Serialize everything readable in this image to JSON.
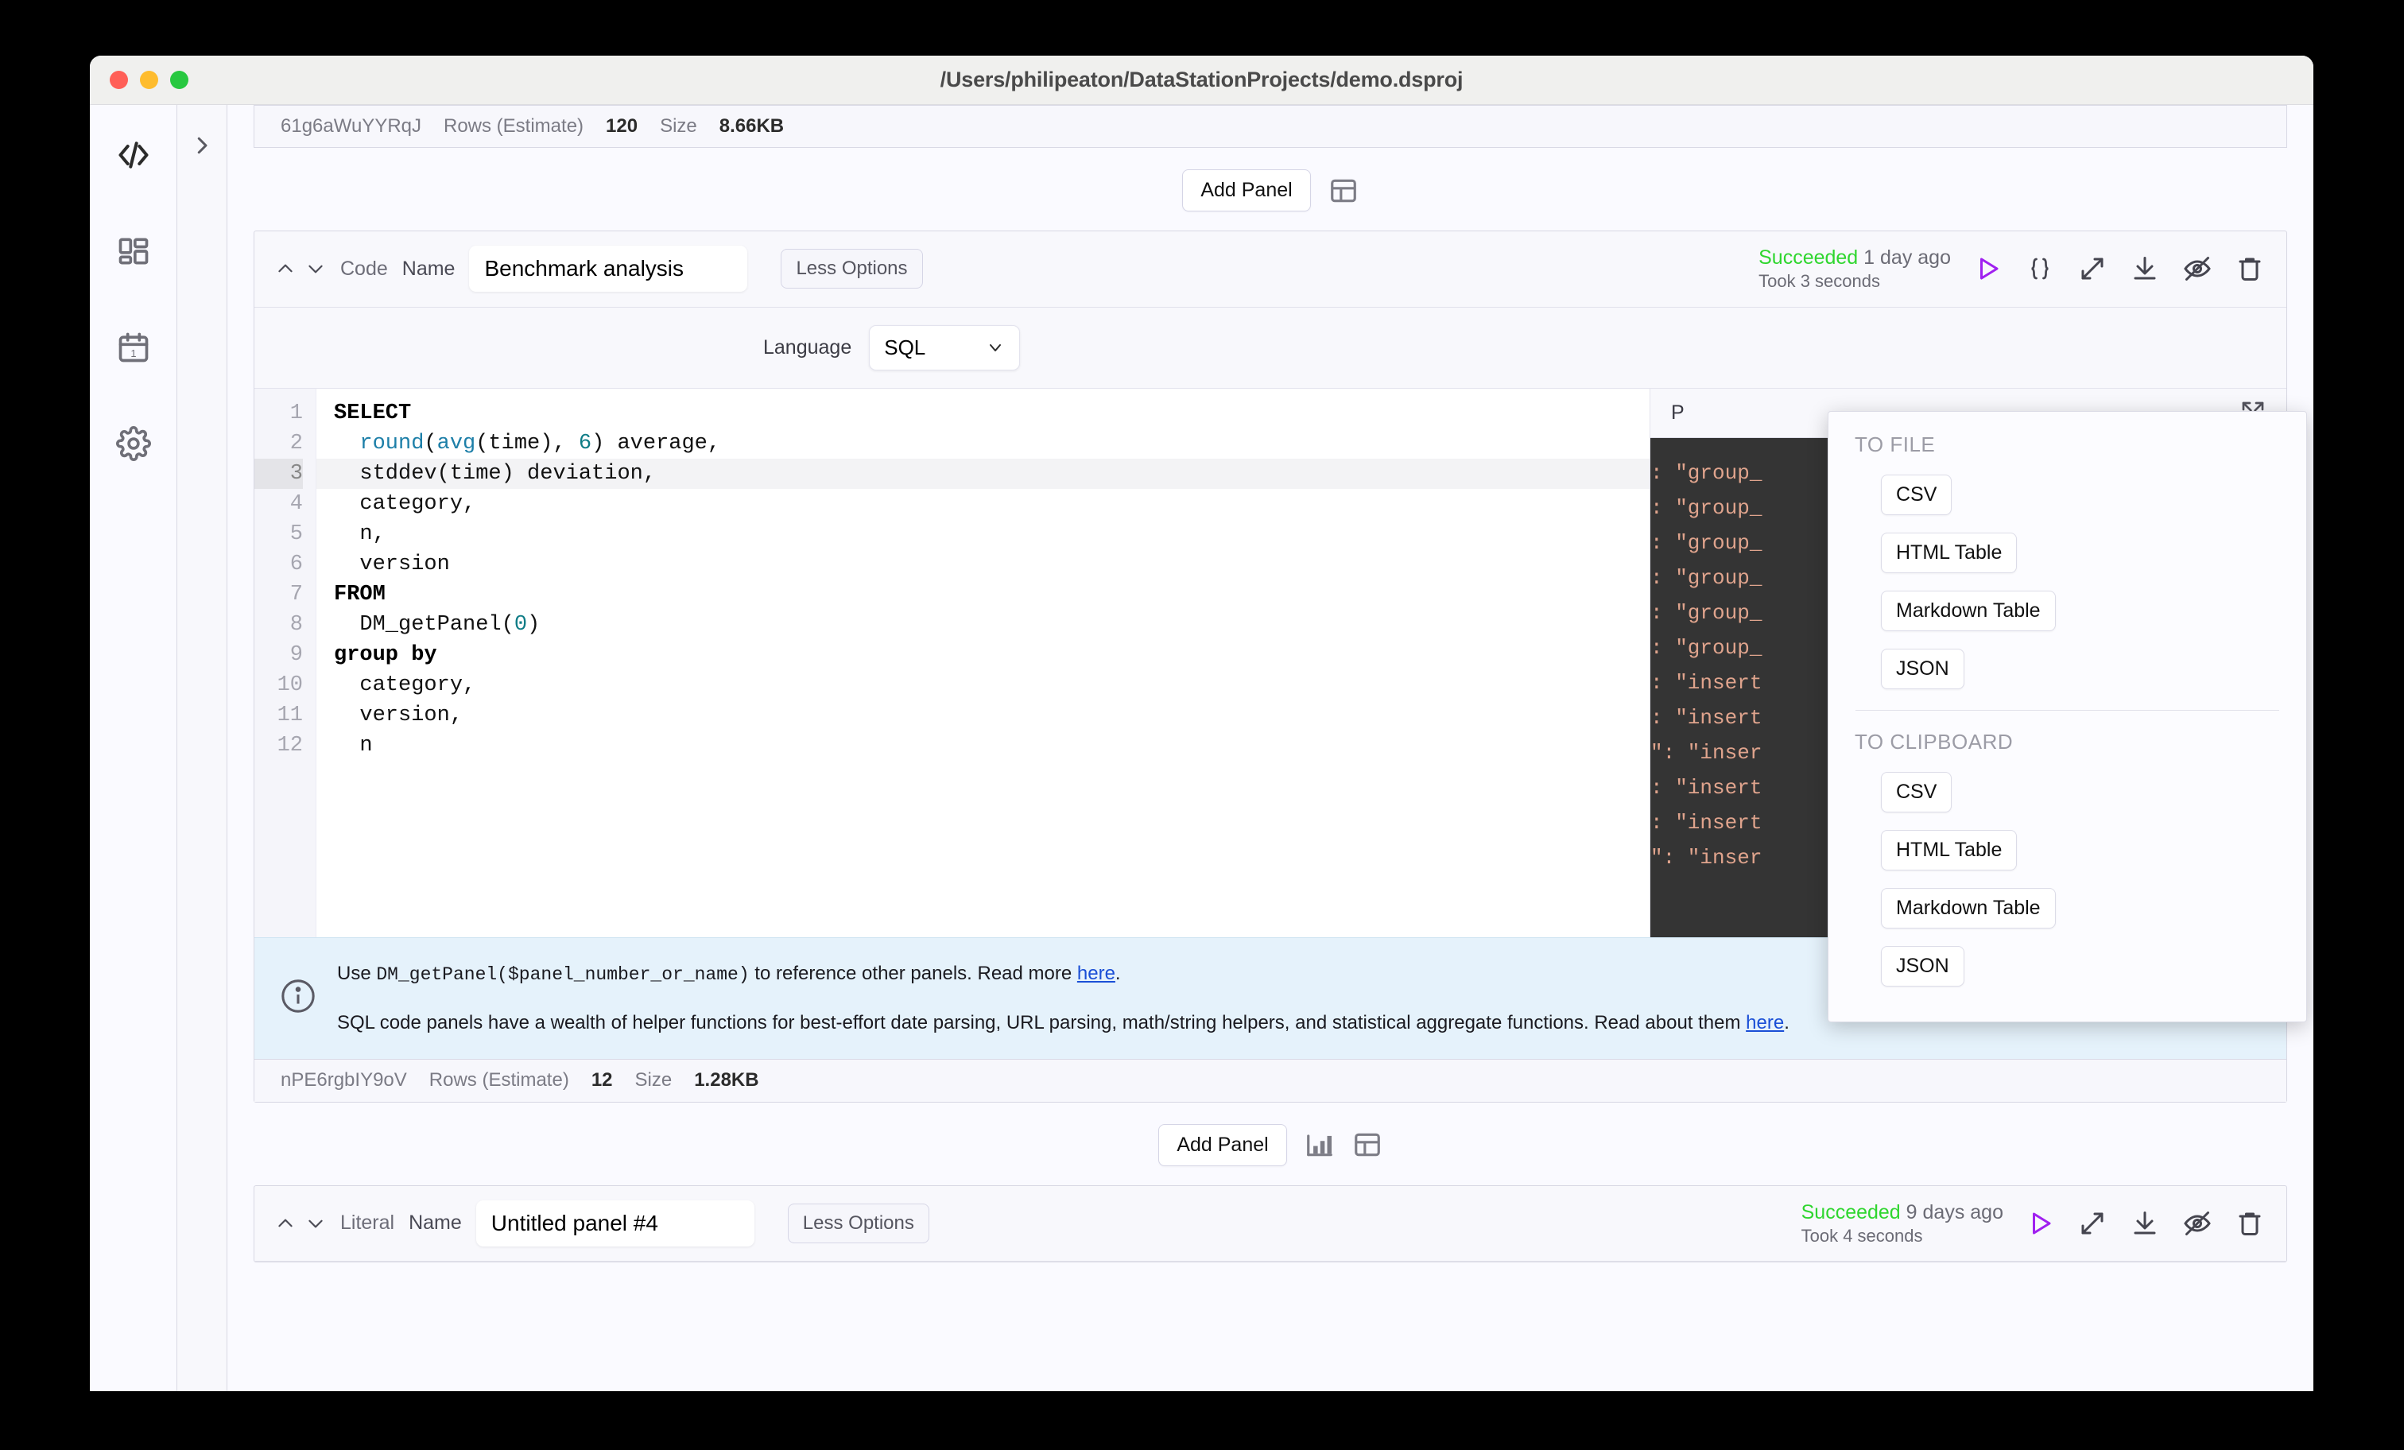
{
  "window": {
    "title": "/Users/philipeaton/DataStationProjects/demo.dsproj",
    "traffic_lights": [
      "close",
      "minimize",
      "zoom"
    ]
  },
  "sidebar": {
    "items": [
      {
        "name": "code-editor",
        "icon": "code-brackets-icon"
      },
      {
        "name": "dashboard",
        "icon": "dashboard-grid-icon"
      },
      {
        "name": "schedule",
        "icon": "calendar-icon"
      },
      {
        "name": "settings",
        "icon": "gear-icon"
      }
    ],
    "expand_icon": "chevron-right-icon"
  },
  "top_panel_footer": {
    "id": "61g6aWuYYRqJ",
    "rows_label": "Rows (Estimate)",
    "rows_value": "120",
    "size_label": "Size",
    "size_value": "8.66KB"
  },
  "add_panel_top": {
    "label": "Add Panel",
    "icons": [
      "table-icon"
    ]
  },
  "panel": {
    "type": "Code",
    "name_label": "Name",
    "name_value": "Benchmark analysis",
    "options_button": "Less Options",
    "status": "Succeeded",
    "status_time": "1 day ago",
    "duration": "Took 3 seconds",
    "actions": [
      "play-icon",
      "braces-icon",
      "expand-diagonal-icon",
      "download-icon",
      "eye-off-icon",
      "trash-icon"
    ],
    "language_label": "Language",
    "language_value": "SQL",
    "editor": {
      "lines": [
        {
          "n": "1",
          "active": false,
          "tokens": [
            {
              "t": "SELECT",
              "c": "kw"
            }
          ]
        },
        {
          "n": "2",
          "active": false,
          "tokens": [
            {
              "t": "  ",
              "c": ""
            },
            {
              "t": "round",
              "c": "fn"
            },
            {
              "t": "(",
              "c": ""
            },
            {
              "t": "avg",
              "c": "fn"
            },
            {
              "t": "(time), ",
              "c": ""
            },
            {
              "t": "6",
              "c": "num"
            },
            {
              "t": ") average,",
              "c": ""
            }
          ]
        },
        {
          "n": "3",
          "active": true,
          "tokens": [
            {
              "t": "  stddev(time) deviation,",
              "c": ""
            }
          ]
        },
        {
          "n": "4",
          "active": false,
          "tokens": [
            {
              "t": "  category,",
              "c": ""
            }
          ]
        },
        {
          "n": "5",
          "active": false,
          "tokens": [
            {
              "t": "  n,",
              "c": ""
            }
          ]
        },
        {
          "n": "6",
          "active": false,
          "tokens": [
            {
              "t": "  version",
              "c": ""
            }
          ]
        },
        {
          "n": "7",
          "active": false,
          "tokens": [
            {
              "t": "FROM",
              "c": "kw"
            }
          ]
        },
        {
          "n": "8",
          "active": false,
          "tokens": [
            {
              "t": "  DM_getPanel(",
              "c": ""
            },
            {
              "t": "0",
              "c": "num"
            },
            {
              "t": ")",
              "c": ""
            }
          ]
        },
        {
          "n": "9",
          "active": false,
          "tokens": [
            {
              "t": "group by",
              "c": "kw"
            }
          ]
        },
        {
          "n": "10",
          "active": false,
          "tokens": [
            {
              "t": "  category,",
              "c": ""
            }
          ]
        },
        {
          "n": "11",
          "active": false,
          "tokens": [
            {
              "t": "  version,",
              "c": ""
            }
          ]
        },
        {
          "n": "12",
          "active": false,
          "tokens": [
            {
              "t": "  n",
              "c": ""
            }
          ]
        }
      ]
    },
    "results": {
      "title": "P",
      "expand_icon": "expand-arrows-icon",
      "lines": [
        ": \"group_",
        ": \"group_",
        ": \"group_",
        ": \"group_",
        ": \"group_",
        ": \"group_",
        ": \"insert",
        ": \"insert",
        "\": \"inser",
        ": \"insert",
        ": \"insert",
        "\": \"inser"
      ]
    },
    "info": {
      "icon": "info-circle-icon",
      "line1_pre": "Use ",
      "line1_code": "DM_getPanel($panel_number_or_name)",
      "line1_mid": " to reference other panels. Read more ",
      "line1_link": "here",
      "line1_post": ".",
      "line2_pre": "SQL code panels have a wealth of helper functions for best-effort date parsing, URL parsing, math/string helpers, and statistical aggregate functions. Read about them ",
      "line2_link": "here",
      "line2_post": "."
    },
    "footer": {
      "id": "nPE6rgbIY9oV",
      "rows_label": "Rows (Estimate)",
      "rows_value": "12",
      "size_label": "Size",
      "size_value": "1.28KB"
    }
  },
  "add_panel_bottom": {
    "label": "Add Panel",
    "icons": [
      "bar-chart-icon",
      "table-icon"
    ]
  },
  "panel_bottom": {
    "type": "Literal",
    "name_label": "Name",
    "name_value": "Untitled panel #4",
    "options_button": "Less Options",
    "status": "Succeeded",
    "status_time": "9 days ago",
    "duration": "Took 4 seconds",
    "actions": [
      "play-icon",
      "expand-diagonal-icon",
      "download-icon",
      "eye-off-icon",
      "trash-icon"
    ]
  },
  "export_menu": {
    "sections": [
      {
        "title": "TO FILE",
        "items": [
          "CSV",
          "HTML Table",
          "Markdown Table",
          "JSON"
        ]
      },
      {
        "title": "TO CLIPBOARD",
        "items": [
          "CSV",
          "HTML Table",
          "Markdown Table",
          "JSON"
        ]
      }
    ]
  },
  "colors": {
    "accent_purple": "#a020f0",
    "success_green": "#2fd62f",
    "link_blue": "#1a4fd6",
    "info_bg": "#e5f2fb",
    "editor_dark": "#343434"
  }
}
